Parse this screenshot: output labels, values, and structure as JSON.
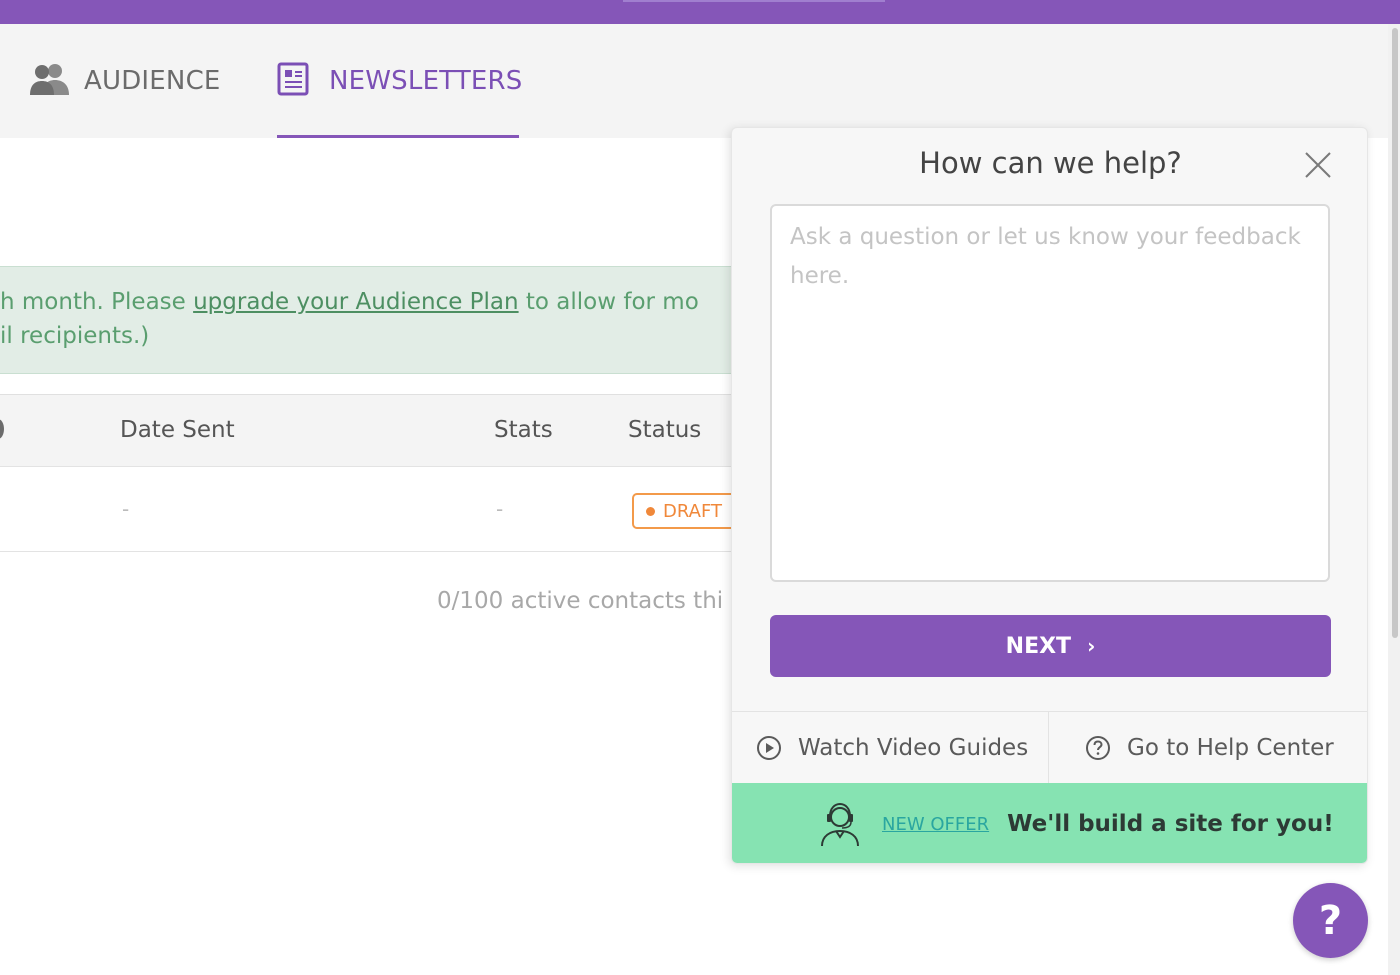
{
  "nav": {
    "tabs": [
      {
        "label": "AUDIENCE",
        "icon": "people-icon"
      },
      {
        "label": "NEWSLETTERS",
        "icon": "newsletter-icon",
        "active": true
      }
    ]
  },
  "notice": {
    "text_before": "h month. Please ",
    "link": "upgrade your Audience Plan",
    "text_after": " to allow for mo",
    "line2": "il recipients.)"
  },
  "table": {
    "headers": [
      "Date Sent",
      "Stats",
      "Status"
    ],
    "row": {
      "date_sent": "-",
      "stats": "-",
      "status": "DRAFT"
    }
  },
  "contacts_note": "0/100 active contacts thi",
  "help_panel": {
    "title": "How can we help?",
    "textarea_placeholder": "Ask a question or let us know your feedback here.",
    "next_label": "NEXT",
    "links": [
      {
        "label": "Watch Video Guides",
        "icon": "play-circle-icon"
      },
      {
        "label": "Go to Help Center",
        "icon": "question-circle-icon"
      }
    ],
    "offer": {
      "tag": "NEW OFFER",
      "text": "We'll build a site for you!",
      "icon": "support-agent-icon"
    }
  },
  "fab": {
    "label": "?"
  },
  "colors": {
    "brand": "#8556b8",
    "offer_bg": "#86e3b2",
    "draft": "#f0883a",
    "notice_text": "#5a9e6f"
  }
}
